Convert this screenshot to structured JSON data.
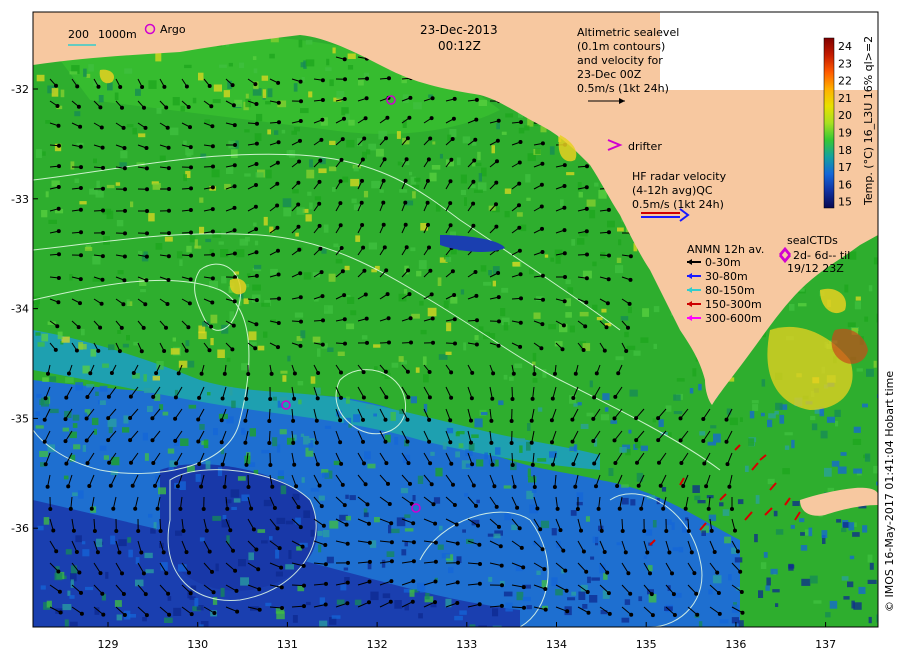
{
  "title": {
    "date": "23-Dec-2013",
    "time": "00:12Z"
  },
  "scale_bar": {
    "label_200": "200",
    "label_1000": "1000m"
  },
  "argo": {
    "label": "Argo"
  },
  "altimetry": {
    "lines": [
      "Altimetric sealevel",
      "(0.1m contours)",
      "and velocity for",
      "23-Dec 00Z",
      "0.5m/s (1kt 24h)"
    ]
  },
  "drifter": {
    "label": "drifter"
  },
  "hf_radar": {
    "lines": [
      "HF radar velocity",
      "(4-12h avg)QC",
      "0.5m/s (1kt 24h)"
    ]
  },
  "anmn": {
    "title": "ANMN 12h av.",
    "items": [
      {
        "label": "0-30m",
        "color": "#000000"
      },
      {
        "label": "30-80m",
        "color": "#1a1aff"
      },
      {
        "label": "80-150m",
        "color": "#33cccc"
      },
      {
        "label": "150-300m",
        "color": "#cc0000"
      },
      {
        "label": "300-600m",
        "color": "#ff00ff"
      }
    ]
  },
  "sealctds": {
    "title": "sealCTDs",
    "line1": "2d- 6d-- til",
    "line2": "19/12 23Z"
  },
  "colorbar": {
    "label": "Temp. (°C) 16_L3U 16% ql>=2",
    "ticks": [
      "24",
      "23",
      "22",
      "21",
      "20",
      "19",
      "18",
      "17",
      "16",
      "15"
    ],
    "colors": [
      "#7f0000",
      "#c41a00",
      "#ff5a00",
      "#ffb000",
      "#e8e000",
      "#a8e020",
      "#34c834",
      "#14a0a0",
      "#1466d8",
      "#1030a0",
      "#080850"
    ]
  },
  "x_axis": {
    "ticks": [
      "129",
      "130",
      "131",
      "132",
      "133",
      "134",
      "135",
      "136",
      "137"
    ]
  },
  "y_axis": {
    "ticks": [
      "-32",
      "-33",
      "-34",
      "-35",
      "-36"
    ]
  },
  "credit": "© IMOS 16-May-2017 01:41:04 Hobart time",
  "colors": {
    "land": "#f7c8a0",
    "ocean_base": "#2ca82c"
  }
}
